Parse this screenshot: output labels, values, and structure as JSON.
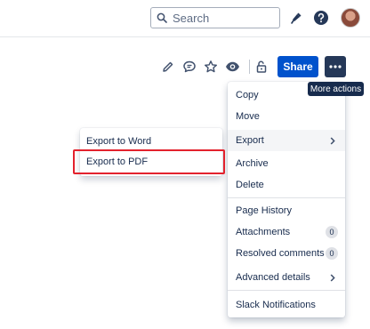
{
  "topbar": {
    "search_placeholder": "Search",
    "icons": [
      "search-icon",
      "notification-icon",
      "help-icon"
    ],
    "avatar": "user-avatar"
  },
  "page_actions": {
    "icons": [
      "edit-icon",
      "comment-icon",
      "star-icon",
      "watch-icon",
      "restrictions-icon"
    ],
    "share_label": "Share",
    "more_icon": "more-actions-icon",
    "more_tooltip": "More actions",
    "colors": {
      "share": "#0052cc",
      "more": "#253858",
      "tooltip": "#172b4d"
    }
  },
  "more_menu": {
    "items": [
      {
        "label": "Copy"
      },
      {
        "label": "Move"
      },
      {
        "label": "Export",
        "has_submenu": true
      },
      {
        "label": "Archive"
      },
      {
        "label": "Delete"
      },
      {
        "label": "Page History"
      },
      {
        "label": "Attachments",
        "count": "0"
      },
      {
        "label": "Resolved comments",
        "count": "0"
      },
      {
        "label": "Advanced details",
        "has_submenu": true
      },
      {
        "label": "Slack Notifications"
      }
    ]
  },
  "export_submenu": {
    "items": [
      {
        "label": "Export to Word"
      },
      {
        "label": "Export to PDF",
        "highlighted": true
      }
    ],
    "highlight_color": "#e3222d"
  }
}
